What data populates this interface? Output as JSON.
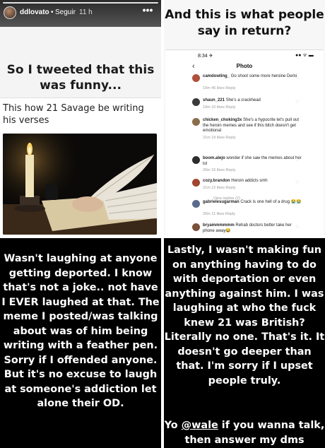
{
  "story": {
    "username": "ddlovato",
    "separator": "•",
    "follow_label": "Seguir",
    "timestamp": "11 h",
    "more_label": "•••"
  },
  "panel1": {
    "title": "So I tweeted that this was funny...",
    "tweet_text": "This how 21 Savage be writing his verses"
  },
  "panel2": {
    "heading": "And this is what people say in return?",
    "status_time": "8:34 ✈",
    "status_icons": "●● ᯤ ▬",
    "back_icon": "‹",
    "screen_title": "Photo",
    "view_replies": "View replies (2)",
    "comments": [
      {
        "user": "camdowling_",
        "text": "Go shoot some more heroine Demi",
        "meta": "19m   46 likes   Reply",
        "color": "#b0503c"
      },
      {
        "user": "shaun_221",
        "text": "She's a crackhead",
        "meta": "19m   10 likes   Reply",
        "color": "#3a3a3a"
      },
      {
        "user": "chicken_choking3x",
        "text": "She's a hypocrite let's pull out the heroin memes and see if this bitch doesn't get emotional",
        "meta": "21m   19 likes   Reply",
        "color": "#8c6d4a"
      },
      {
        "user": "boom.alejo",
        "text": "wonder if she saw the memes about her lol",
        "meta": "20m   16 likes   Reply",
        "color": "#2d2d2d"
      },
      {
        "user": "cozy.brandon",
        "text": "Heroin addicts smh",
        "meta": "21m   12 likes   Reply",
        "color": "#a0452f"
      },
      {
        "user": "gabrielesugarman",
        "text": "Crack is one hell of a drug 😭😭",
        "meta": "20m   11 likes   Reply",
        "color": "#5a6b8c"
      },
      {
        "user": "bryammmmmm",
        "text": "Rehab doctors better take her phone away😂",
        "meta": "",
        "color": "#7a5038"
      }
    ]
  },
  "panel3": {
    "text": "Wasn't laughing at anyone getting deported. I know that's not a joke.. not have I EVER laughed at that. The meme I posted/was talking about was of him being writing with a feather pen. Sorry if I offended anyone. But it's no excuse to laugh at someone's addiction let alone their OD."
  },
  "panel4": {
    "text": "Lastly, I wasn't making fun on anything having to do with deportation or even anything against him. I was laughing at who the fuck knew 21 was British? Literally no one. That's it. It doesn't go deeper than that. I'm sorry if I upset people truly.",
    "sub_prefix": "Yo ",
    "mention": "@wale",
    "sub_suffix": " if you wanna talk, then answer my dms"
  },
  "colors": {
    "black_panel": "#000000",
    "header_bg": "#2a2a2a"
  }
}
